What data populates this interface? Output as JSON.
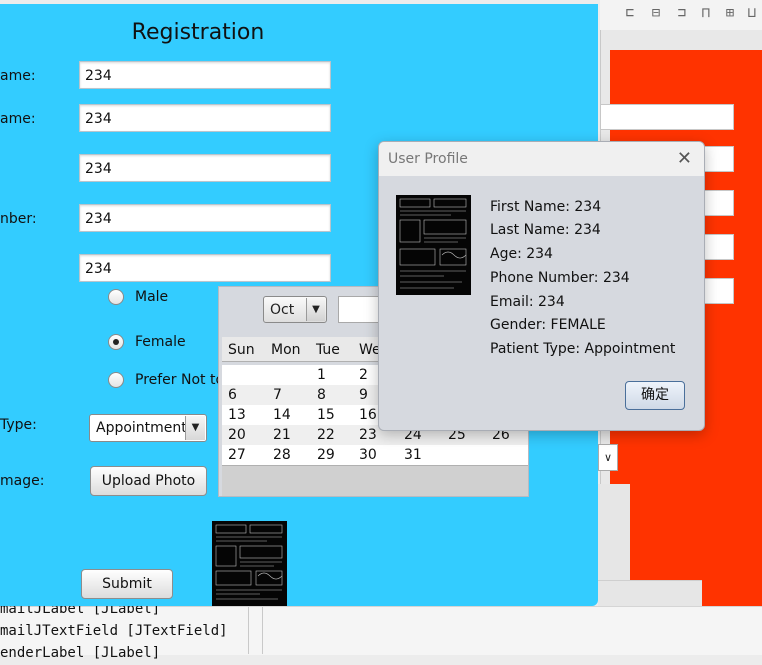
{
  "registration": {
    "title": "Registration",
    "labels": {
      "first_name": "ame:",
      "last_name": "ame:",
      "phone": "nber:",
      "type": "Type:",
      "image": "mage:"
    },
    "fields": {
      "first_name": "234",
      "last_name": "234",
      "age": "234",
      "phone": "234",
      "email": "234"
    },
    "gender_options": [
      {
        "label": "Male",
        "selected": false
      },
      {
        "label": "Female",
        "selected": true
      },
      {
        "label": "Prefer Not to",
        "selected": false
      }
    ],
    "patient_type": "Appointment",
    "upload_button": "Upload Photo",
    "submit_button": "Submit"
  },
  "calendar": {
    "month": "Oct",
    "weekdays": [
      "Sun",
      "Mon",
      "Tue",
      "We"
    ],
    "rows": [
      [
        "",
        "",
        "1",
        "2"
      ],
      [
        "6",
        "7",
        "8",
        "9"
      ],
      [
        "13",
        "14",
        "15",
        "16"
      ],
      [
        "20",
        "21",
        "22",
        "23",
        "24",
        "25",
        "26"
      ],
      [
        "27",
        "28",
        "29",
        "30",
        "31"
      ]
    ]
  },
  "profile_dialog": {
    "title": "User Profile",
    "close_icon": "close-icon",
    "lines": [
      "First Name: 234",
      "Last Name: 234",
      "Age: 234",
      "Phone Number: 234",
      "Email: 234",
      "Gender: FEMALE",
      "Patient Type: Appointment"
    ],
    "ok_button": "确定"
  },
  "ide_background": {
    "tree_lines": [
      "mailJLabel [JLabel]",
      "mailJTextField [JTextField]",
      "enderLabel [JLabel]"
    ],
    "accent_color": "#ff3300"
  }
}
